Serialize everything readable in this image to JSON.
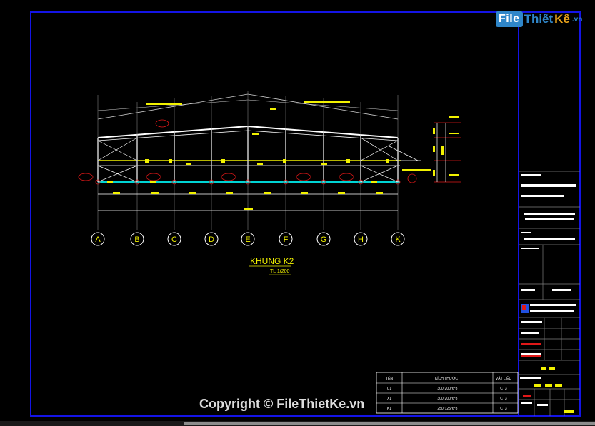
{
  "drawing": {
    "title": "KHUNG K2",
    "scale": "TL 1/200"
  },
  "grid_axes": [
    "A",
    "B",
    "C",
    "D",
    "E",
    "F",
    "G",
    "H",
    "K"
  ],
  "materials_table": {
    "headers": [
      "TÊN",
      "KÍCH THƯỚC",
      "VẬT LIỆU"
    ],
    "rows": [
      [
        "C1",
        "I 300*200*6*8",
        "CT3"
      ],
      [
        "X1",
        "I 300*200*6*8",
        "CT3"
      ],
      [
        "K1",
        "I 250*125*6*8",
        "CT3"
      ]
    ]
  },
  "watermark": {
    "logo_file": "File",
    "logo_thiet": "Thiết",
    "logo_ke": "Kế",
    "logo_tld": ".vn",
    "copyright": "Copyright © FileThietKe.vn"
  },
  "colors": {
    "background": "#000000",
    "frame": "#1414e6",
    "structure": "#ffffff",
    "yellow": "#f2f200",
    "red": "#e01818",
    "cyan": "#00d4d4",
    "gray_grid": "#7f7f7f"
  }
}
